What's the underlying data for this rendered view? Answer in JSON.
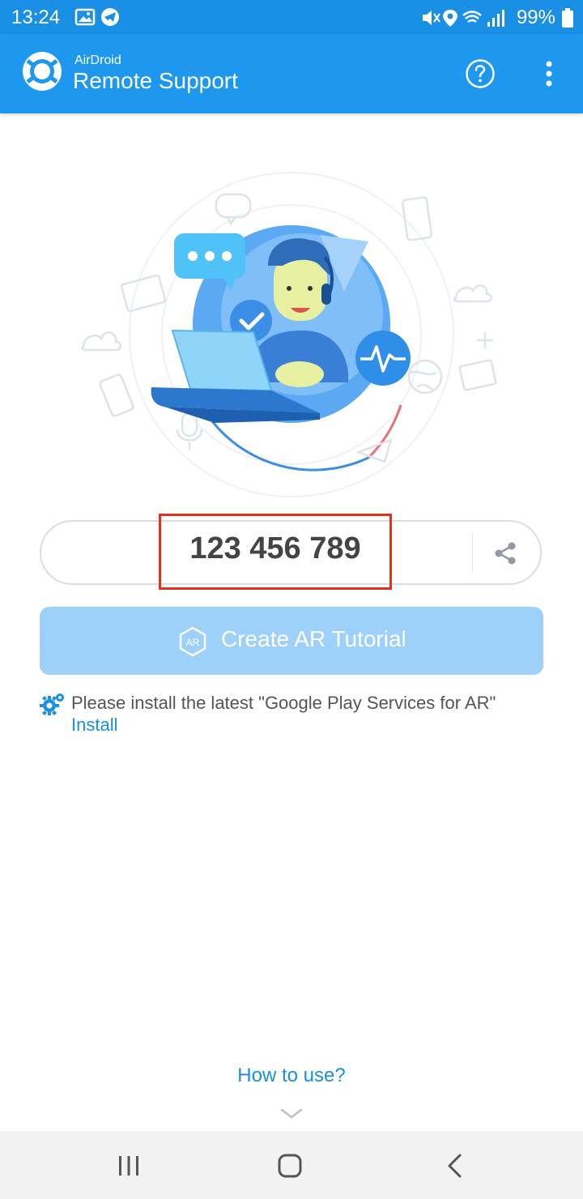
{
  "status_bar": {
    "time": "13:24",
    "battery": "99%",
    "icons": [
      "image-icon",
      "telegram-icon",
      "mute-icon",
      "location-icon",
      "wifi-icon",
      "signal-icon",
      "battery-icon"
    ]
  },
  "app_bar": {
    "brand": "AirDroid",
    "title": "Remote Support",
    "icons": [
      "lifebuoy-logo-icon",
      "help-icon",
      "more-vert-icon"
    ]
  },
  "illustration": {
    "description_icons": [
      "support-agent-illustration",
      "chat-bubble-icon",
      "check-icon",
      "pulse-icon",
      "laptop-icon"
    ]
  },
  "connection_id": {
    "value": "123 456 789",
    "share_icon": "share-icon"
  },
  "ar_button": {
    "label": "Create AR Tutorial",
    "icon_text": "AR"
  },
  "notice": {
    "text": "Please install the latest \"Google Play Services for AR\"",
    "link": "Install"
  },
  "footer": {
    "how_to_use": "How to use?"
  },
  "colors": {
    "primary": "#1e97ee",
    "status_bar": "#1a8fe6",
    "ar_button": "#9dd1f9",
    "highlight": "#e2311f",
    "link": "#1a8fe6"
  }
}
